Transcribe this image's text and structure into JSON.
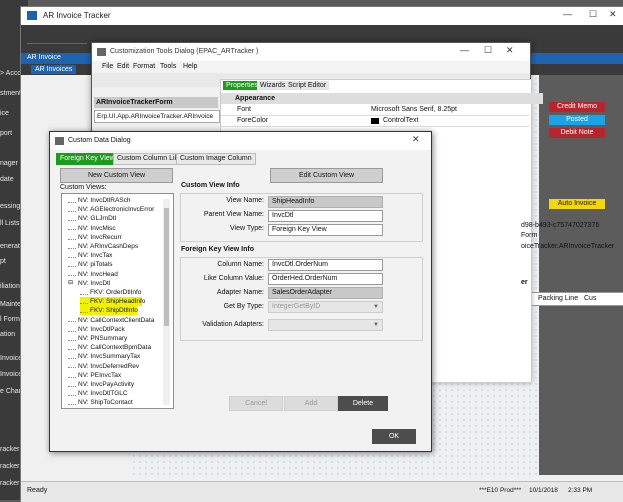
{
  "leftnav": {
    "items": [
      "> Acco",
      "stment",
      "ice",
      "port",
      "nager",
      "date",
      "essing",
      "ll Lists",
      "eneration",
      "pt",
      "iliation",
      "Mainten",
      "l Forms",
      "ation",
      "Invoices",
      "Invoices",
      "e Charg",
      "racker",
      "racker",
      "racker"
    ]
  },
  "ar_window": {
    "title": "AR Invoice Tracker",
    "header": "AR Invoice",
    "tab": "AR Invoices",
    "status_left": "Ready",
    "status_env": "***E10 Prod***",
    "status_date": "10/1/2018",
    "status_time": "2:33 PM",
    "right_buttons": [
      {
        "label": "Credit Memo",
        "color": "#b8242e"
      },
      {
        "label": "Posted",
        "color": "#1aa3e8"
      },
      {
        "label": "Debit Note",
        "color": "#b8242e"
      },
      {
        "label": "Auto Invoice",
        "color": "#f5d800"
      }
    ],
    "packing_tab": "Packing Line",
    "packing_tab2": "Cus"
  },
  "customization_dialog": {
    "title": "Customization Tools Dialog  (EPAC_ARTracker )",
    "menu": [
      "File",
      "Edit",
      "Format",
      "Tools",
      "Help"
    ],
    "form_name": "ARInvoiceTrackerForm",
    "form_class": "Erp.UI.App.ARInvoiceTracker.ARInvoice",
    "prop_tabs": [
      "Properties",
      "Wizards",
      "Script Editor"
    ],
    "prop_section": "Appearance",
    "prop_rows": [
      {
        "name": "Font",
        "value": "Microsoft Sans Serif, 8.25pt"
      },
      {
        "name": "ForeColor",
        "value": "ControlText"
      }
    ],
    "guid_fragment": "d98-b493-c75747027376",
    "form_fragment": "Form",
    "tracker_fragment": "oiceTracker.ARInvoiceTracker",
    "er_fragment": "er"
  },
  "custom_data_dialog": {
    "title": "Custom Data Dialog",
    "tabs": [
      "Foreign Key View",
      "Custom Column Like",
      "Custom Image Column"
    ],
    "new_button": "New Custom View",
    "edit_button": "Edit Custom View",
    "custom_views_label": "Custom Views:",
    "tree": [
      {
        "text": "NV: InvcDtlRASch",
        "level": 0
      },
      {
        "text": "NV: AGElectronicInvcError",
        "level": 0
      },
      {
        "text": "NV: GLJrnDtl",
        "level": 0
      },
      {
        "text": "NV: InvcMisc",
        "level": 0
      },
      {
        "text": "NV: InvcRecurr",
        "level": 0
      },
      {
        "text": "NV: ARInvCashDeps",
        "level": 0
      },
      {
        "text": "NV: InvcTax",
        "level": 0
      },
      {
        "text": "NV: piTotals",
        "level": 0
      },
      {
        "text": "NV: InvcHead",
        "level": 0
      },
      {
        "text": "NV: InvcDtl",
        "level": 0,
        "expanded": true
      },
      {
        "text": "FKV: OrderDtlInfo",
        "level": 1
      },
      {
        "text": "FKV: ShipHeadInfo",
        "level": 1,
        "highlight": true
      },
      {
        "text": "FKV: ShipDtlInfo",
        "level": 1,
        "highlight": true
      },
      {
        "text": "NV: CallContextClientData",
        "level": 0
      },
      {
        "text": "NV: InvcDtlPack",
        "level": 0
      },
      {
        "text": "NV: PNSummary",
        "level": 0
      },
      {
        "text": "NV: CallContextBpmData",
        "level": 0
      },
      {
        "text": "NV: InvcSummaryTax",
        "level": 0
      },
      {
        "text": "NV: InvcDeferredRev",
        "level": 0
      },
      {
        "text": "NV: PEInvcTax",
        "level": 0
      },
      {
        "text": "NV: InvcPayActivity",
        "level": 0
      },
      {
        "text": "NV: InvcDtlTGLC",
        "level": 0
      },
      {
        "text": "NV: ShipToContact",
        "level": 0
      }
    ],
    "info_title": "Custom View Info",
    "view_name_label": "View Name:",
    "view_name_value": "ShipHeadInfo",
    "parent_view_label": "Parent View Name:",
    "parent_view_value": "InvcDtl",
    "view_type_label": "View Type:",
    "view_type_value": "Foreign Key View",
    "fk_title": "Foreign Key View Info",
    "column_name_label": "Column Name:",
    "column_name_value": "InvcDtl.OrderNum",
    "like_column_label": "Like Column Value:",
    "like_column_value": "OrderHed.OrderNum",
    "adapter_label": "Adapter Name:",
    "adapter_value": "SalesOrderAdapter",
    "get_by_label": "Get By Type:",
    "get_by_value": "IntegerGetByID",
    "validation_label": "Validation Adapters:",
    "validation_value": "",
    "cancel_button": "Cancel",
    "add_button": "Add",
    "delete_button": "Delete",
    "ok_button": "OK"
  }
}
